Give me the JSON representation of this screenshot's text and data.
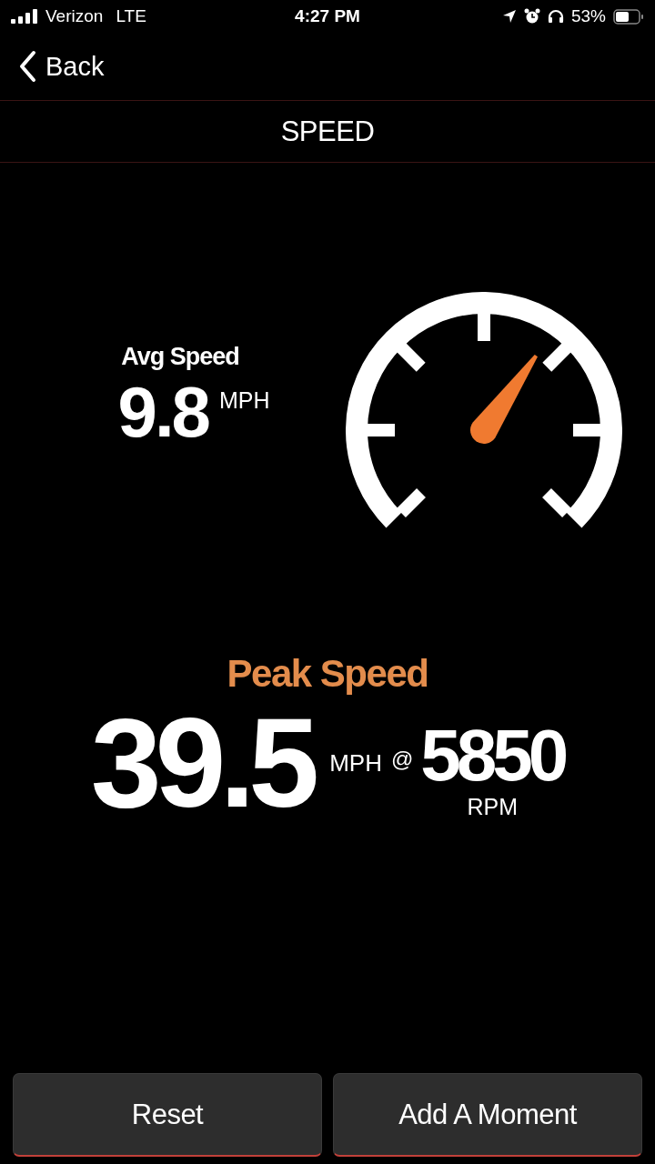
{
  "status_bar": {
    "carrier": "Verizon",
    "network": "LTE",
    "time": "4:27 PM",
    "battery": "53%"
  },
  "nav": {
    "back": "Back",
    "title": "SPEED"
  },
  "avg": {
    "label": "Avg Speed",
    "value": "9.8",
    "unit": "MPH"
  },
  "peak": {
    "label": "Peak Speed",
    "value": "39.5",
    "unit": "MPH",
    "at": "@",
    "rpm": "5850",
    "rpm_unit": "RPM"
  },
  "buttons": [
    {
      "label": "Reset"
    },
    {
      "label": "Add A Moment"
    }
  ]
}
